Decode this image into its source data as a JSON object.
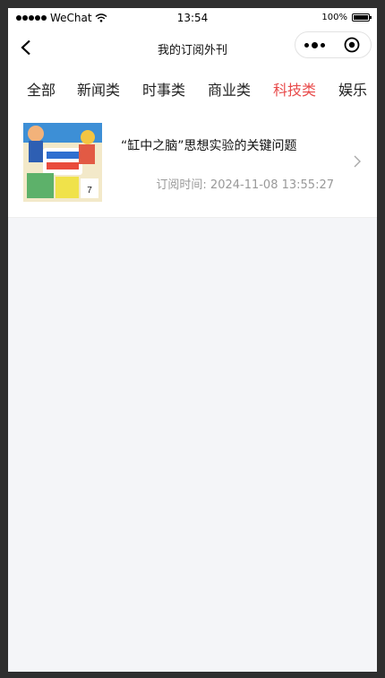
{
  "status_bar": {
    "carrier": "WeChat",
    "time": "13:54",
    "battery_percent": "100%"
  },
  "nav": {
    "title": "我的订阅外刊"
  },
  "tabs": [
    {
      "label": "全部"
    },
    {
      "label": "新闻类"
    },
    {
      "label": "时事类"
    },
    {
      "label": "商业类"
    },
    {
      "label": "科技类",
      "active": true
    },
    {
      "label": "娱乐"
    }
  ],
  "articles": [
    {
      "title": "“缸中之脑”思想实验的关键问题",
      "subscribed_time": "订阅时间: 2024-11-08 13:55:27"
    }
  ],
  "colors": {
    "accent": "#e84b4b",
    "background": "#f4f5f8",
    "frame": "#2f2f2f"
  }
}
